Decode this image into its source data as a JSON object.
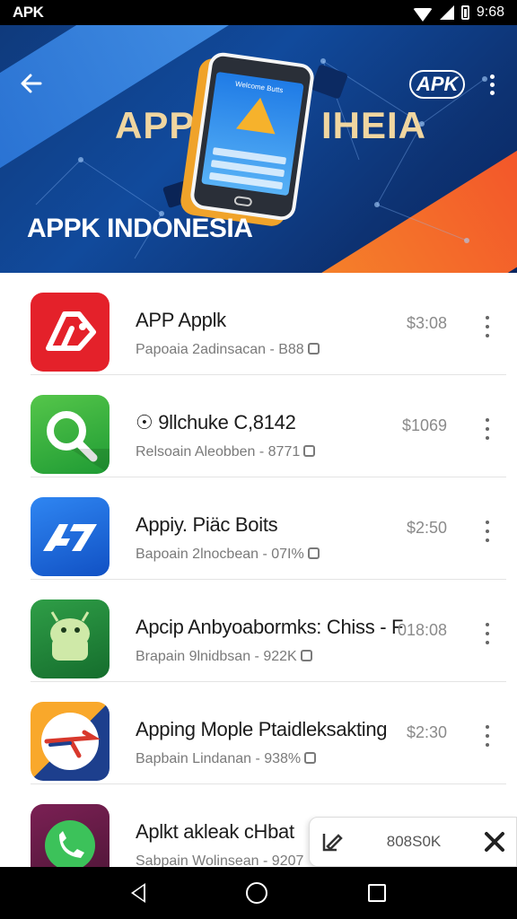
{
  "status_bar": {
    "carrier_logo": "APK",
    "time": "9:68",
    "icons": [
      "wifi-icon",
      "signal-icon",
      "battery-icon"
    ]
  },
  "hero": {
    "title_left": "APP",
    "title_right": "IHEIA",
    "phone_screen_title": "Welcome Butts",
    "brand_label": "APPK INDONESIA",
    "top_right_logo": "APK",
    "colors": {
      "background": "#114a9c",
      "accent_orange": "#f6902a",
      "accent_red": "#e9392c"
    }
  },
  "apps": [
    {
      "name": "APP Applk",
      "subtitle": "Papoaia 2adinsacan - B88",
      "price": "$3:08",
      "icon": "apk-red-icon",
      "color": "#e4212a"
    },
    {
      "name": "☉ 9llchuke C,8142",
      "subtitle": "Relsoain Aleobben - 8771",
      "price": "$1069",
      "icon": "green-magnifier-icon",
      "color": "#2faa3e"
    },
    {
      "name": "Appiy. Piäc Boits",
      "subtitle": "Bapoain 2lnocbean - 07I%",
      "price": "$2:50",
      "icon": "blue-a7-icon",
      "color": "#1f6fe0"
    },
    {
      "name": "Apcip Anbyoabormks: Chiss - F",
      "subtitle": "Brapain 9lnidbsan - 922K",
      "price": "018:08",
      "icon": "android-icon",
      "color": "#2f9e47"
    },
    {
      "name": "Apping Mople Ptaidleksakting",
      "subtitle": "Bapbain Lindanan - 938%",
      "price": "$2:30",
      "icon": "plane-icon",
      "color": "#f9a82b"
    },
    {
      "name": "Aplkt akleak cHbat",
      "subtitle": "Sabpain Wolinsean - 9207",
      "price": "",
      "icon": "phone-chat-icon",
      "color": "#7b2054"
    }
  ],
  "floating_chip": {
    "text": "808S0K",
    "edit_icon": "edit-icon",
    "close_icon": "close-icon"
  },
  "nav_bar": {
    "buttons": [
      "nav-back-icon",
      "nav-home-icon",
      "nav-recent-icon"
    ]
  }
}
